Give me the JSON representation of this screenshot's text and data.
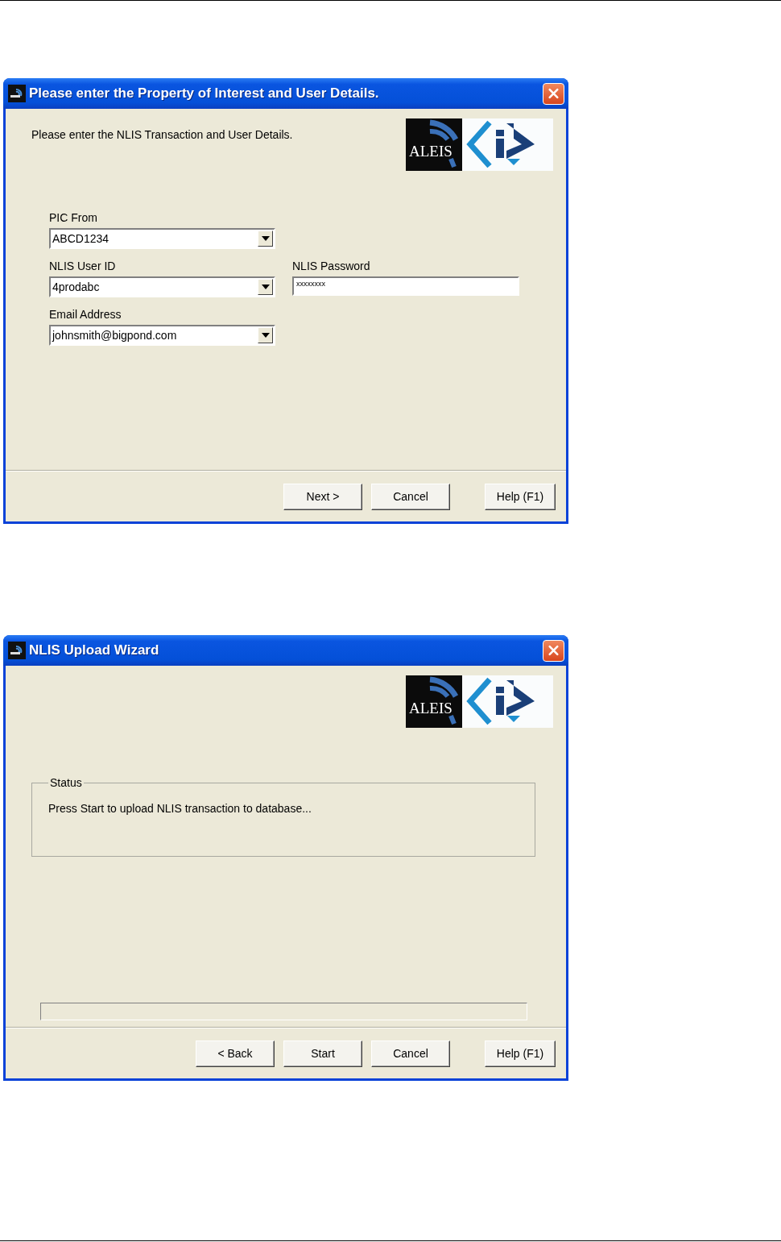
{
  "windows": [
    {
      "kind": "details",
      "title": "Please enter the Property of Interest and User Details.",
      "logo_text": "ALEIS",
      "intro": "Please enter the NLIS Transaction and User Details.",
      "fields": [
        {
          "kind": "combo",
          "label": "PIC From",
          "value": "ABCD1234"
        },
        {
          "kind": "combo",
          "label": "NLIS User ID",
          "value": "4prodabc"
        },
        {
          "kind": "password",
          "label": "NLIS Password",
          "value": "xxxxxxxx"
        },
        {
          "kind": "combo",
          "label": "Email Address",
          "value": "johnsmith@bigpond.com"
        }
      ],
      "buttons": [
        "Next >",
        "Cancel",
        "Help (F1)"
      ]
    },
    {
      "kind": "upload",
      "title": "NLIS Upload Wizard",
      "logo_text": "ALEIS",
      "status": {
        "legend": "Status",
        "message": "Press Start to upload NLIS transaction to database..."
      },
      "progress": {
        "level": 0
      },
      "buttons": [
        "< Back",
        "Start",
        "Cancel",
        "Help (F1)"
      ]
    }
  ]
}
